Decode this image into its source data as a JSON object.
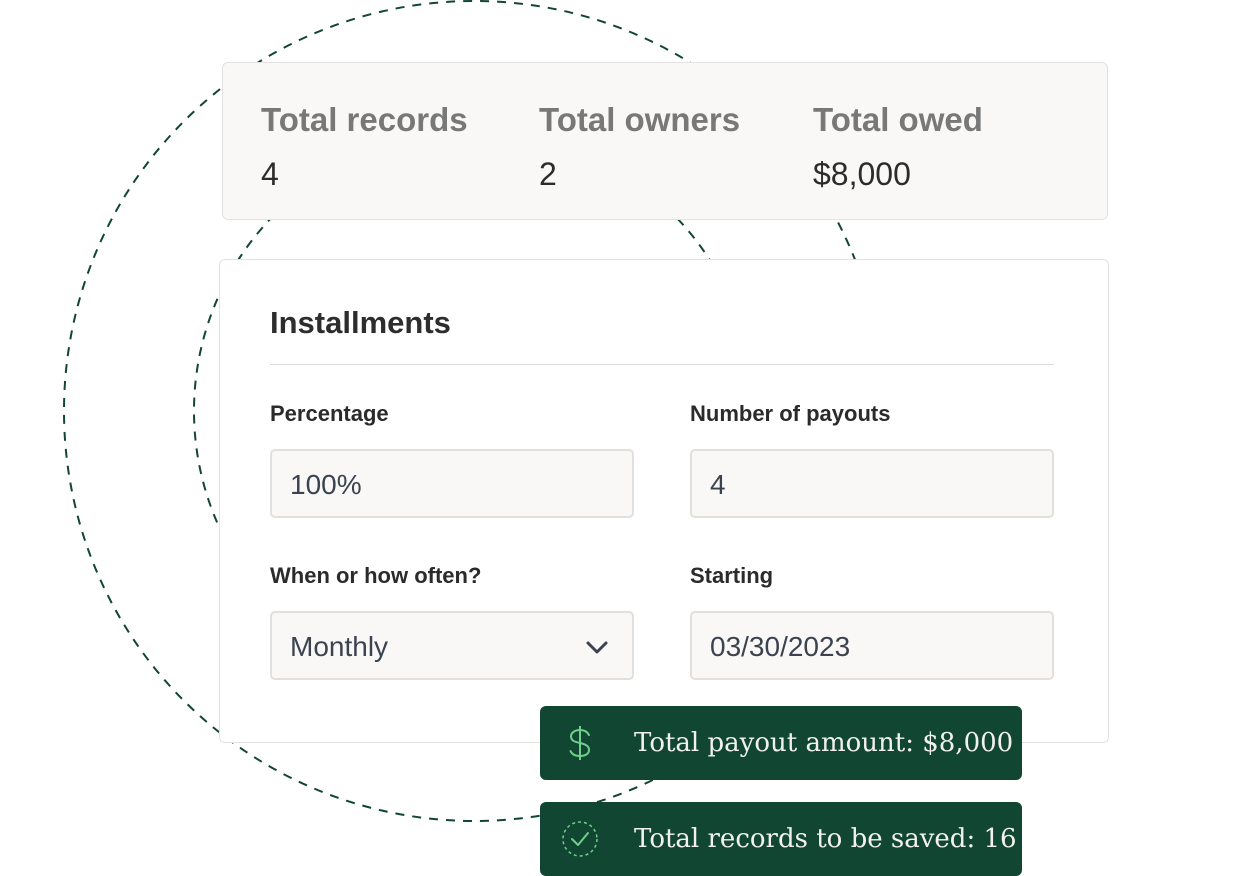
{
  "stats": [
    {
      "label": "Total records",
      "value": "4"
    },
    {
      "label": "Total owners",
      "value": "2"
    },
    {
      "label": "Total owed",
      "value": "$8,000"
    }
  ],
  "installments": {
    "title": "Installments",
    "percentage": {
      "label": "Percentage",
      "value": "100%"
    },
    "payouts": {
      "label": "Number of payouts",
      "value": "4"
    },
    "frequency": {
      "label": "When or how often?",
      "value": "Monthly"
    },
    "starting": {
      "label": "Starting",
      "value": "03/30/2023"
    }
  },
  "toasts": {
    "payout": {
      "icon": "dollar-icon",
      "text": "Total payout amount: $8,000"
    },
    "records": {
      "icon": "check-circle-icon",
      "text": "Total records to be saved: 16"
    }
  },
  "colors": {
    "toast_bg": "#114632",
    "icon_green": "#6fd08a",
    "decor_dash": "#114632"
  }
}
